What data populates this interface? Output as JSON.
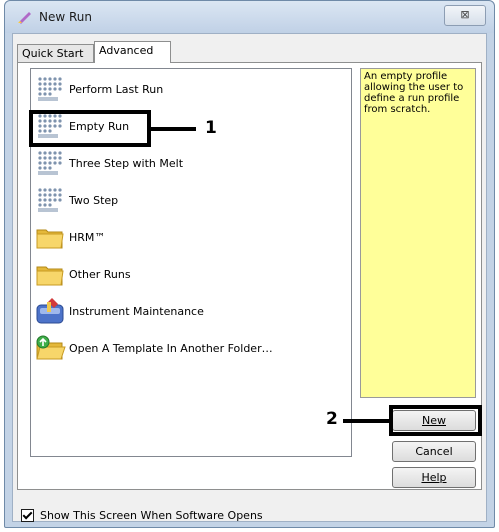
{
  "window": {
    "title": "New Run",
    "close_glyph": "⊠"
  },
  "tabs": [
    {
      "label": "Quick Start",
      "selected": false
    },
    {
      "label": "Advanced",
      "selected": true
    }
  ],
  "list_items": [
    {
      "label": "Perform Last Run",
      "icon": "qiagen-grid-icon"
    },
    {
      "label": "Empty Run",
      "icon": "qiagen-grid-icon"
    },
    {
      "label": "Three Step with Melt",
      "icon": "qiagen-grid-icon"
    },
    {
      "label": "Two Step",
      "icon": "qiagen-grid-icon"
    },
    {
      "label": "HRM™",
      "icon": "folder-icon"
    },
    {
      "label": "Other Runs",
      "icon": "folder-icon"
    },
    {
      "label": "Instrument Maintenance",
      "icon": "maintenance-icon"
    },
    {
      "label": "Open A Template In Another Folder…",
      "icon": "open-folder-icon"
    }
  ],
  "description": "An empty profile allowing the user to define a run profile from scratch.",
  "buttons": {
    "new": "New",
    "cancel": "Cancel",
    "help": "Help"
  },
  "show_on_open": {
    "label": "Show This Screen When Software Opens",
    "checked": true
  },
  "callouts": {
    "one": "1",
    "two": "2"
  },
  "colors": {
    "highlight": "#000000",
    "description_bg": "#ffff99",
    "window_frame": "#c3d3e6"
  }
}
